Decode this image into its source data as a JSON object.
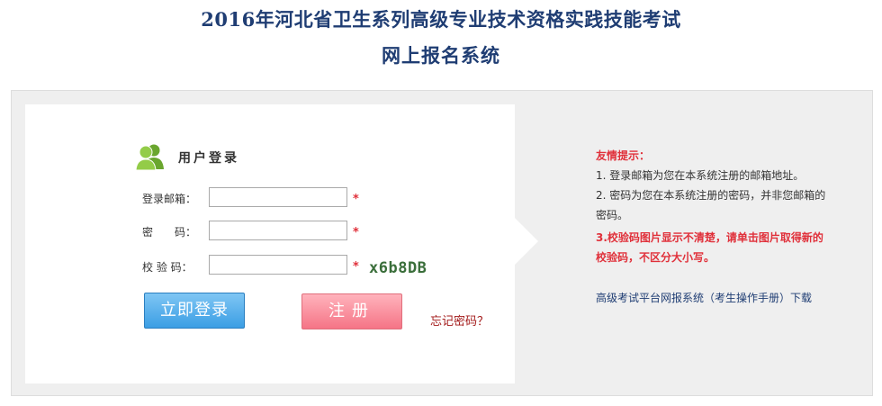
{
  "header": {
    "title_line1": "2016年河北省卫生系列高级专业技术资格实践技能考试",
    "title_line2": "网上报名系统"
  },
  "login": {
    "heading": "用户登录",
    "email_label": "登录邮箱：",
    "password_label": "密　　码：",
    "captcha_label": "校 验 码：",
    "required_mark": "*",
    "captcha_text": "x6b8DB",
    "login_button": "立即登录",
    "register_button": "注册",
    "forgot_link": "忘记密码？"
  },
  "tips": {
    "title": "友情提示：",
    "item1": "1.  登录邮箱为您在本系统注册的邮箱地址。",
    "item2_a": "2.  密码为您在本系统注册的密码，并非您邮箱的",
    "item2_b": "密码。",
    "item3_a": "3.校验码图片显示不清楚，请单击图片取得新的",
    "item3_b": "校验码，不区分大小写。",
    "download_link": "高级考试平台网报系统（考生操作手册）下载"
  },
  "colors": {
    "title": "#1f3d73",
    "required": "#e0303a",
    "login_button": "#3b9ee4",
    "register_button": "#f57486",
    "forgot_link": "#a31a1a",
    "captcha": "#3a6e3a"
  },
  "icons": {
    "user_group": "users-icon"
  }
}
